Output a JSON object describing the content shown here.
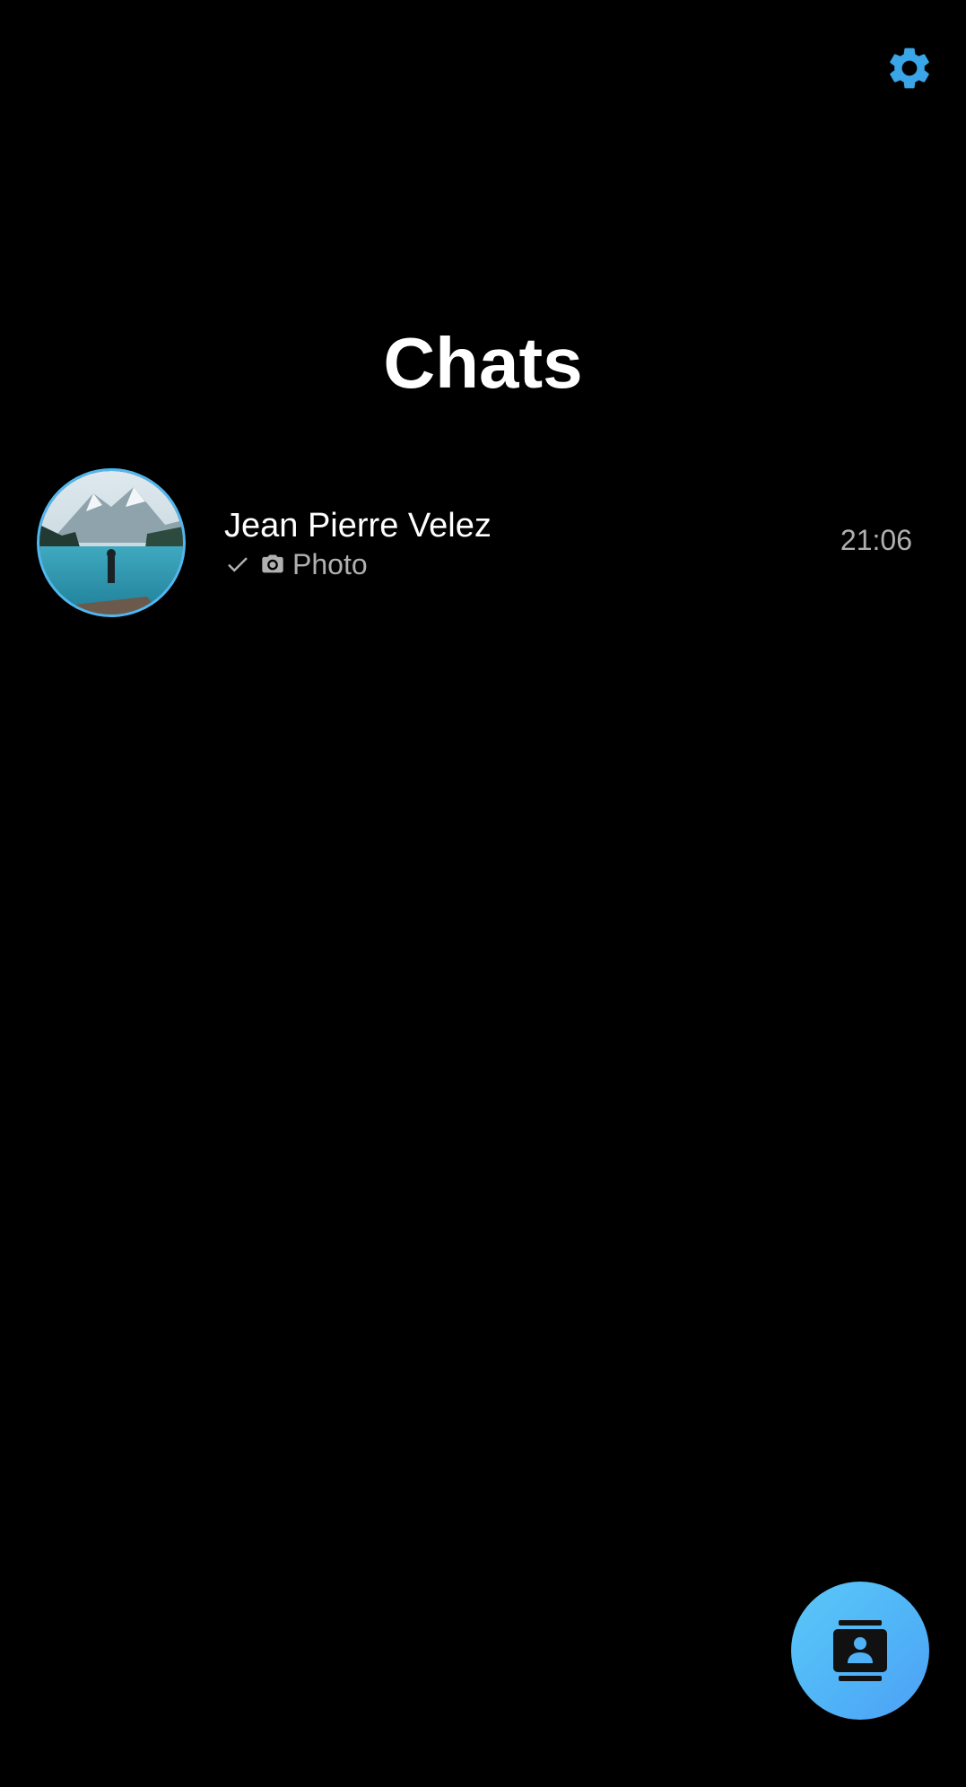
{
  "header": {
    "settings_icon": "gear-icon",
    "title": "Chats"
  },
  "chats": [
    {
      "name": "Jean Pierre Velez",
      "status_icon": "check-icon",
      "attachment_icon": "camera-icon",
      "preview": "Photo",
      "time": "21:06",
      "avatar": "lake-mountain-photo"
    }
  ],
  "fab": {
    "icon": "contacts-icon"
  },
  "colors": {
    "background": "#000000",
    "accent": "#4fb8f0",
    "text_primary": "#ffffff",
    "text_secondary": "#b0b0b0"
  }
}
